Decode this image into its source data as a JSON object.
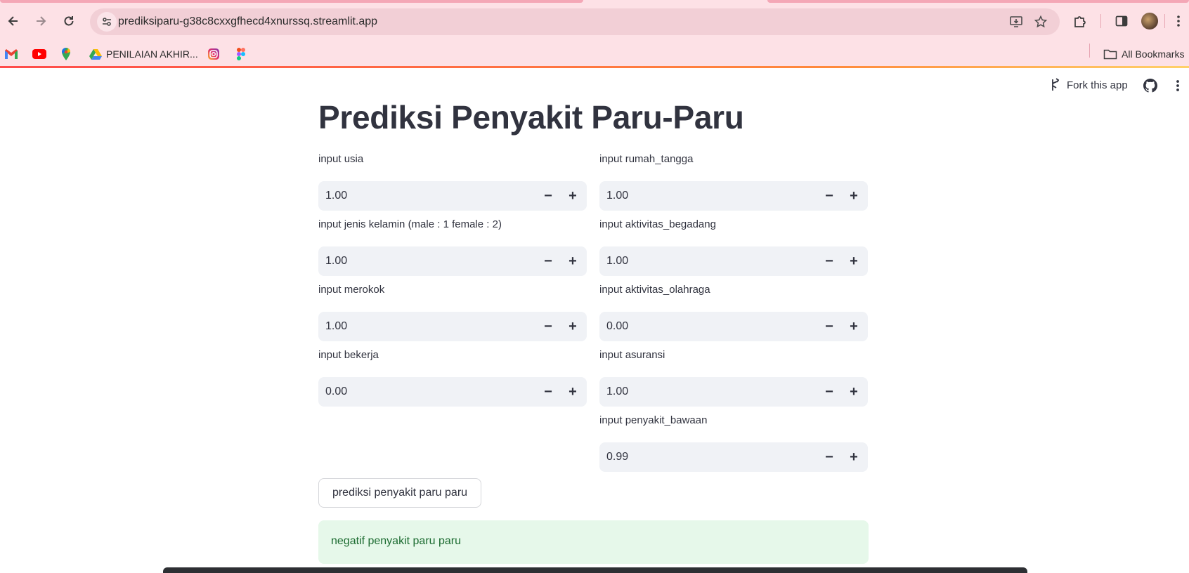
{
  "browser": {
    "url": "prediksiparu-g38c8cxxgfhecd4xnurssq.streamlit.app",
    "bookmarks": {
      "items": [
        {
          "icon": "gmail-icon"
        },
        {
          "icon": "youtube-icon"
        },
        {
          "icon": "maps-icon"
        },
        {
          "icon": "drive-icon",
          "label": "PENILAIAN AKHIR..."
        },
        {
          "icon": "instagram-icon"
        },
        {
          "icon": "figma-icon"
        }
      ],
      "all_bookmarks_label": "All Bookmarks"
    }
  },
  "app_header": {
    "fork_label": "Fork this app"
  },
  "page": {
    "title": "Prediksi Penyakit Paru-Paru",
    "inputs": {
      "usia": {
        "label": "input usia",
        "value": "1.00"
      },
      "jenis_kelamin": {
        "label": "input jenis kelamin (male : 1 female : 2)",
        "value": "1.00"
      },
      "merokok": {
        "label": "input merokok",
        "value": "1.00"
      },
      "bekerja": {
        "label": "input bekerja",
        "value": "0.00"
      },
      "rumah_tangga": {
        "label": "input rumah_tangga",
        "value": "1.00"
      },
      "aktivitas_begadang": {
        "label": "input aktivitas_begadang",
        "value": "1.00"
      },
      "aktivitas_olahraga": {
        "label": "input aktivitas_olahraga",
        "value": "0.00"
      },
      "asuransi": {
        "label": "input asuransi",
        "value": "1.00"
      },
      "penyakit_bawaan": {
        "label": "input penyakit_bawaan",
        "value": "0.99"
      }
    },
    "stepper": {
      "minus": "−",
      "plus": "+"
    },
    "predict_button": "prediksi penyakit paru paru",
    "result": "negatif penyakit paru paru"
  },
  "colors": {
    "chrome_bg": "#fde1e6",
    "omnibox_bg": "#f2cfd6",
    "input_bg": "#f0f2f6",
    "text": "#31333f",
    "success_bg": "#e6f8ea",
    "success_text": "#1b6b30"
  }
}
